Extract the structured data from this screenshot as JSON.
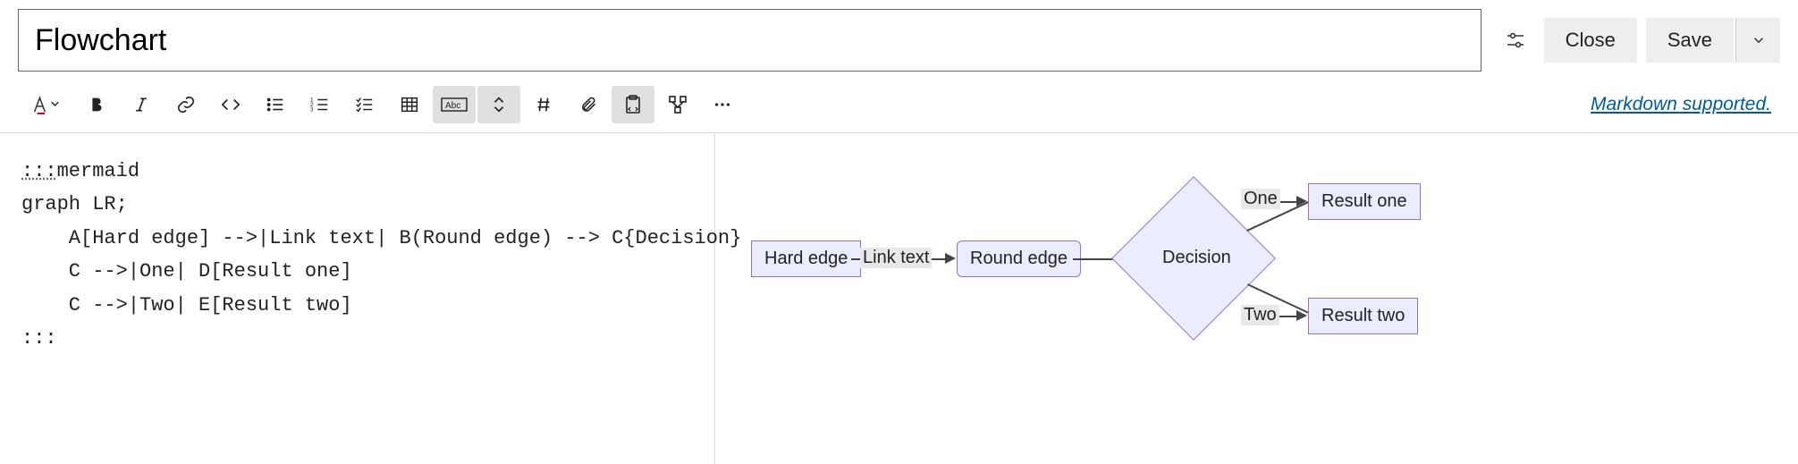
{
  "header": {
    "title_value": "Flowchart",
    "close_label": "Close",
    "save_label": "Save"
  },
  "toolbar": {
    "markdown_link": "Markdown supported."
  },
  "editor": {
    "open_fence": ":::",
    "lang": "mermaid",
    "line2": "graph LR;",
    "line3": "    A[Hard edge] -->|Link text| B(Round edge) --> C{Decision}",
    "line4": "    C -->|One| D[Result one]",
    "line5": "    C -->|Two| E[Result two]",
    "close_fence": ":::"
  },
  "diagram": {
    "nodeA": "Hard edge",
    "nodeB": "Round edge",
    "nodeC": "Decision",
    "nodeD": "Result one",
    "nodeE": "Result two",
    "edgeAB": "Link text",
    "edgeCD": "One",
    "edgeCE": "Two"
  }
}
